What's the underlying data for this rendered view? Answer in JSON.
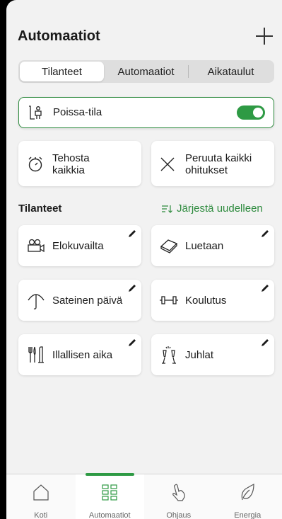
{
  "header": {
    "title": "Automaatiot",
    "add_icon": "plus-icon"
  },
  "tabs": [
    {
      "label": "Tilanteet",
      "active": true
    },
    {
      "label": "Automaatiot",
      "active": false
    },
    {
      "label": "Aikataulut",
      "active": false
    }
  ],
  "away_mode": {
    "label": "Poissa-tila",
    "icon": "person-leaving-icon",
    "enabled": true
  },
  "quick_actions": [
    {
      "label": "Tehosta kaikkia",
      "icon": "timer-icon"
    },
    {
      "label": "Peruuta kaikki ohitukset",
      "icon": "close-icon"
    }
  ],
  "section": {
    "title": "Tilanteet",
    "reorder_label": "Järjestä uudelleen",
    "reorder_icon": "sort-icon"
  },
  "scenes": [
    {
      "label": "Elokuvailta",
      "icon": "camera-icon"
    },
    {
      "label": "Luetaan",
      "icon": "book-icon"
    },
    {
      "label": "Sateinen päivä",
      "icon": "umbrella-icon"
    },
    {
      "label": "Koulutus",
      "icon": "dumbbell-icon"
    },
    {
      "label": "Illallisen aika",
      "icon": "cutlery-icon"
    },
    {
      "label": "Juhlat",
      "icon": "champagne-icon"
    }
  ],
  "bottom_nav": [
    {
      "label": "Koti",
      "icon": "home-icon",
      "active": false
    },
    {
      "label": "Automaatiot",
      "icon": "grid-icon",
      "active": true
    },
    {
      "label": "Ohjaus",
      "icon": "hand-icon",
      "active": false
    },
    {
      "label": "Energia",
      "icon": "leaf-icon",
      "active": false
    }
  ],
  "colors": {
    "accent": "#2e9a44",
    "background": "#f2f2f2",
    "card": "#ffffff"
  }
}
